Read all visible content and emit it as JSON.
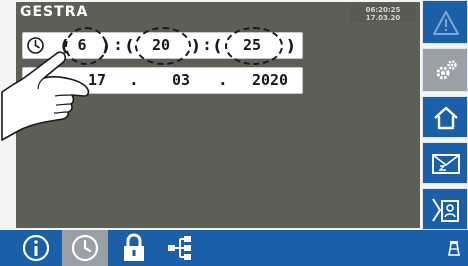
{
  "header": {
    "brand": "GESTRA",
    "clock_time": "06:20:25",
    "clock_date": "17.03.20"
  },
  "time_row": {
    "icon": "clock-icon",
    "hour": "6",
    "minute": "20",
    "second": "25",
    "separator": ":"
  },
  "date_row": {
    "icon": "calendar-icon",
    "day": "17",
    "month": "03",
    "year": "2020",
    "separator": "."
  },
  "sidebar": {
    "items": [
      {
        "icon": "warning-icon",
        "active": false
      },
      {
        "icon": "settings-gears-icon",
        "active": true
      },
      {
        "icon": "home-icon",
        "active": false
      },
      {
        "icon": "message-icon",
        "active": false
      },
      {
        "icon": "user-log-icon",
        "active": false
      }
    ]
  },
  "bottombar": {
    "items": [
      {
        "icon": "info-icon",
        "active": false
      },
      {
        "icon": "clock-icon",
        "active": true
      },
      {
        "icon": "lock-icon",
        "active": false
      },
      {
        "icon": "network-tree-icon",
        "active": false
      }
    ],
    "corner_icon": "tower-icon"
  },
  "colors": {
    "panel": "#5c5f55",
    "nav_blue": "#1a5fa8",
    "active_gray": "#9aa0a6"
  }
}
